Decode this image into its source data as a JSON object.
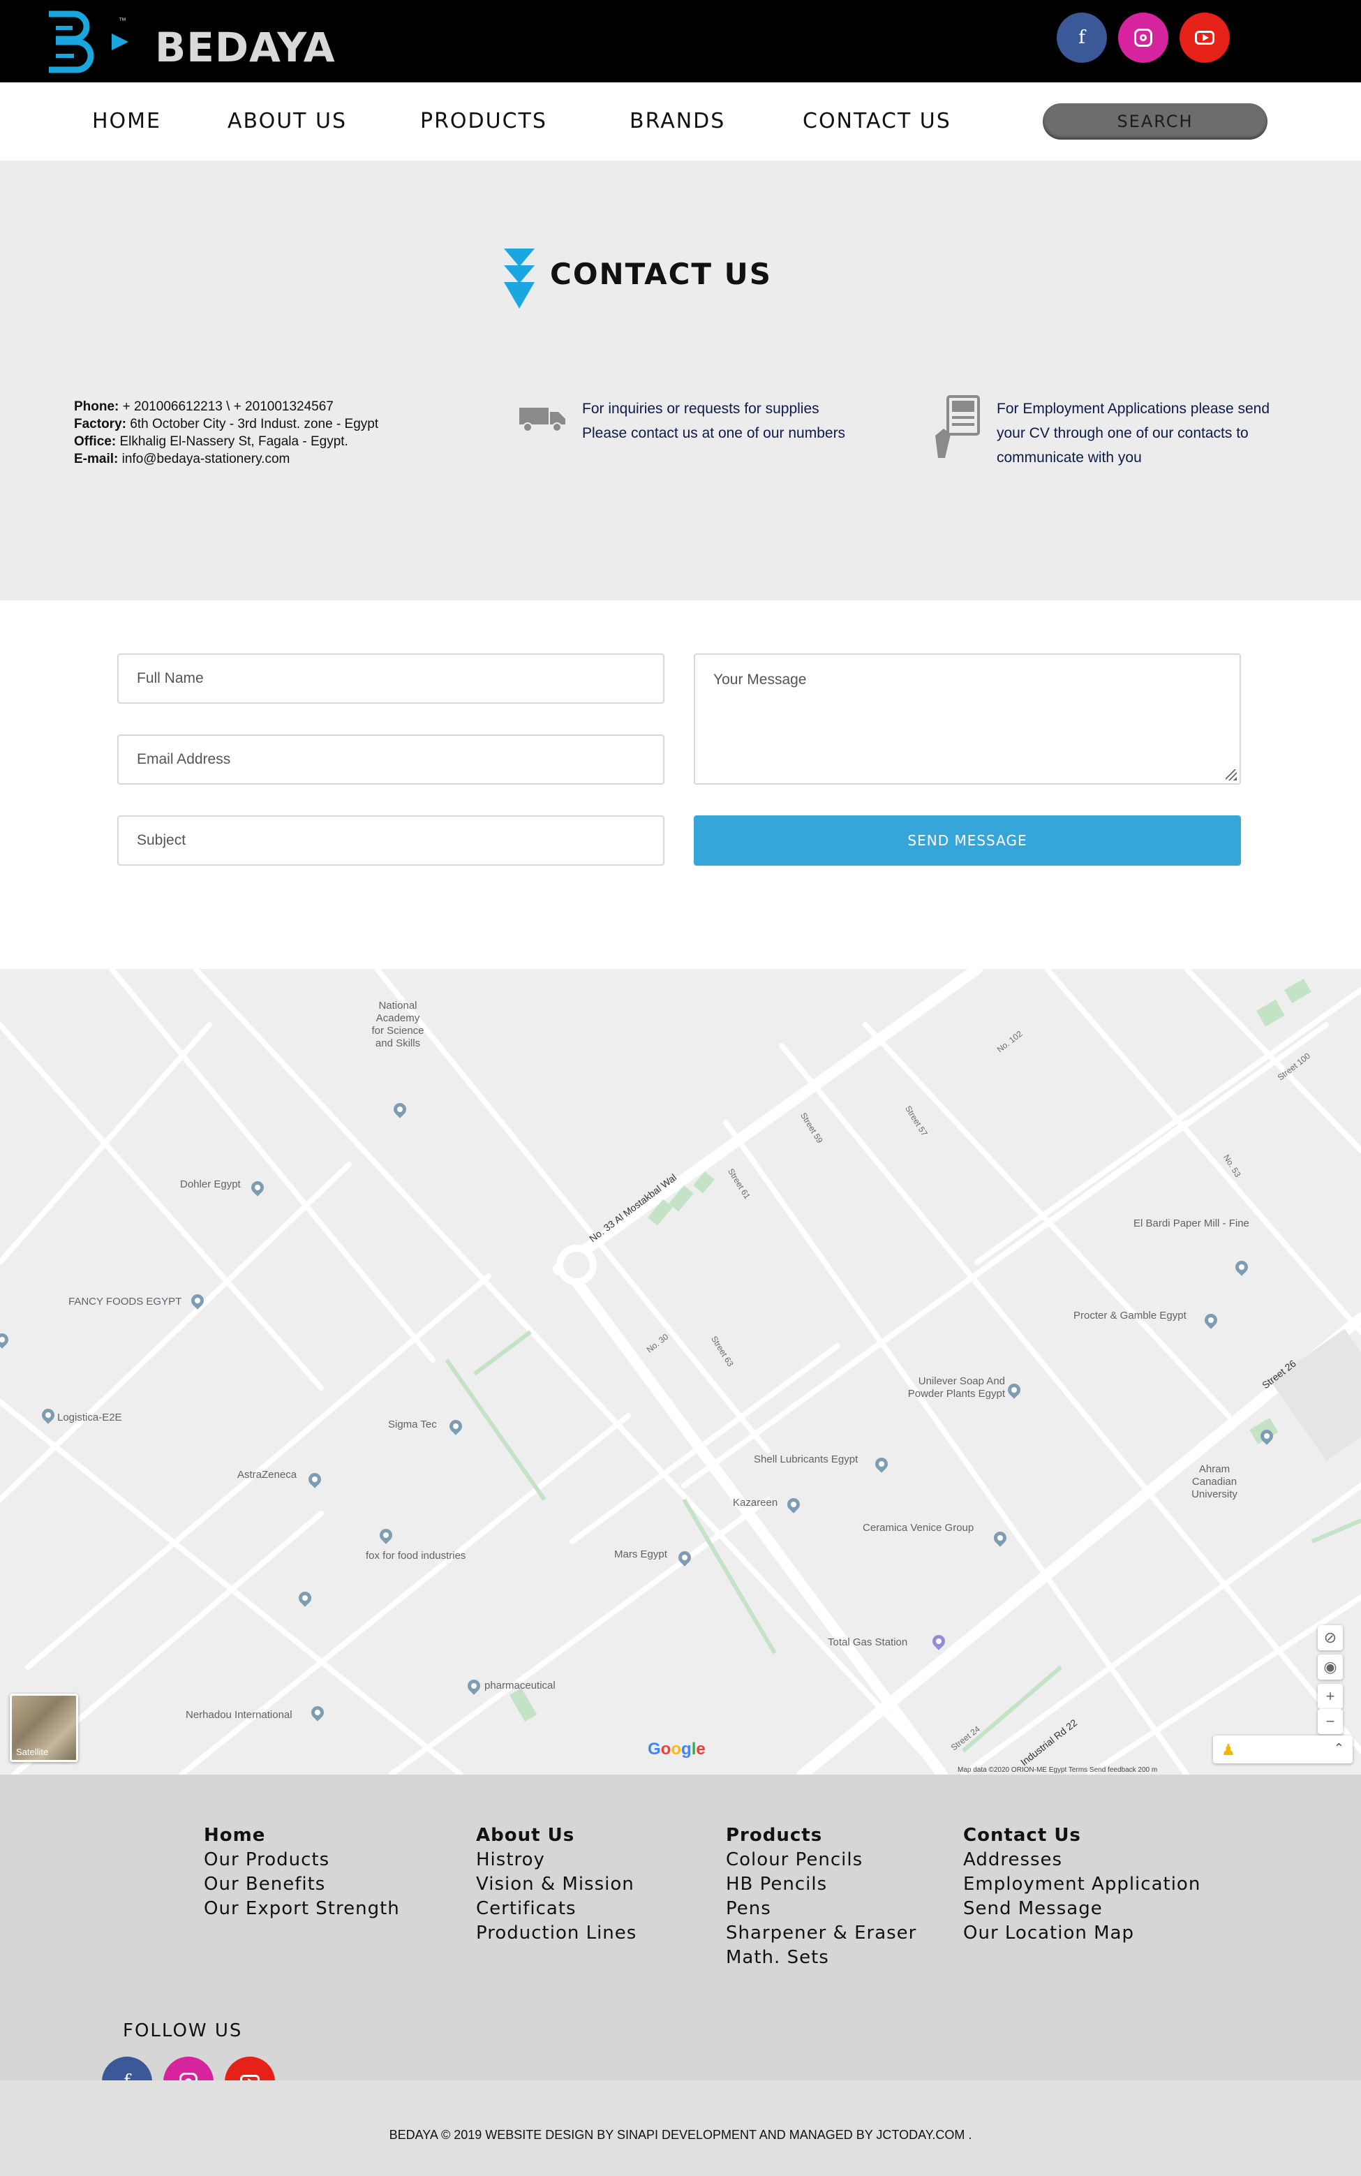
{
  "brand": {
    "name": "BEDAYA",
    "trademark": "™"
  },
  "social": {
    "facebook": "f",
    "instagram": "instagram",
    "youtube": "youtube"
  },
  "nav": {
    "items": [
      "HOME",
      "ABOUT US",
      "PRODUCTS",
      "BRANDS",
      "CONTACT US"
    ],
    "search_label": "SEARCH"
  },
  "contact": {
    "title": "CONTACT US",
    "phone_label": "Phone:",
    "phone": "+ 201006612213 \\ + 201001324567",
    "factory_label": "Factory:",
    "factory": "6th October City - 3rd Indust. zone - Egypt",
    "office_label": "Office:",
    "office": "Elkhalig El-Nassery St, Fagala - Egypt.",
    "email_label": "E-mail:",
    "email": "info@bedaya-stationery.com",
    "inquiries": "For inquiries or requests for supplies Please contact us at one of our numbers",
    "employment": "For Employment Applications please send your CV through one of our contacts to communicate with you"
  },
  "form": {
    "full_name": "Full Name",
    "email": "Email Address",
    "subject": "Subject",
    "message": "Your Message",
    "send": "SEND MESSAGE"
  },
  "map": {
    "pois": [
      "National Academy for Science and Skills",
      "Dohler Egypt",
      "FANCY FOODS EGYPT",
      "Logistica-E2E",
      "Sigma Tec",
      "AstraZeneca",
      "fox for food industries",
      "Mars Egypt",
      "Kazareen",
      "Shell Lubricants Egypt",
      "Unilever Soap And Powder Plants Egypt",
      "Ceramica Venice Group",
      "El Bardi Paper Mill - Fine",
      "Procter & Gamble Egypt",
      "Ahram Canadian University",
      "Total Gas Station",
      "pharmaceutical",
      "Nerhadou International"
    ],
    "streets": [
      "No. 33 Al Mostakbal Wal",
      "Street 26",
      "Industrial Rd 22",
      "Street 59",
      "Street 61",
      "Street 63",
      "Street 57",
      "No. 102",
      "Street 100",
      "No. 53",
      "No. 30",
      "Street 24"
    ],
    "satellite_label": "Satellite",
    "google": "Google",
    "attribution": "Map data ©2020 ORION-ME   Egypt   Terms   Send feedback   200 m"
  },
  "footer": {
    "columns": [
      {
        "heading": "Home",
        "links": [
          "Our Products",
          "Our Benefits",
          "Our Export Strength"
        ]
      },
      {
        "heading": "About Us",
        "links": [
          "Histroy",
          "Vision & Mission",
          "Certificats",
          "Production Lines"
        ]
      },
      {
        "heading": "Products",
        "links": [
          "Colour Pencils",
          "HB Pencils",
          "Pens",
          "Sharpener & Eraser",
          "Math. Sets"
        ]
      },
      {
        "heading": "Contact Us",
        "links": [
          "Addresses",
          "Employment Application",
          "Send Message",
          "Our Location Map"
        ]
      }
    ],
    "follow": "FOLLOW US",
    "copyright": "BEDAYA © 2019 WEBSITE DESIGN BY SINAPI DEVELOPMENT AND MANAGED BY JCTODAY.COM ."
  },
  "colors": {
    "accent": "#36a5d9",
    "logo_blue": "#1aa7e0",
    "facebook": "#3b5998",
    "instagram": "#d6249f",
    "youtube": "#e62117"
  }
}
